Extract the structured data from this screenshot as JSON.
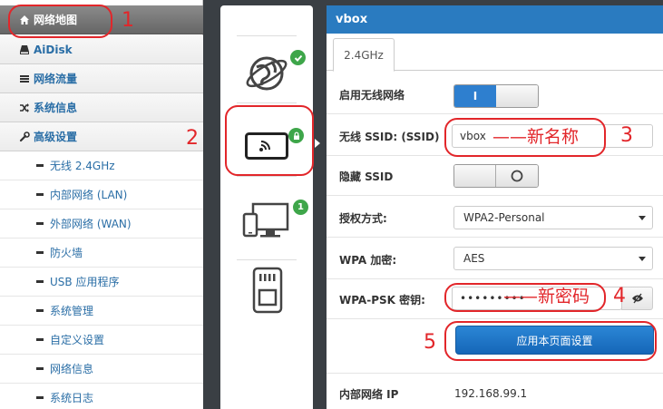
{
  "sidebar": {
    "main_items": [
      {
        "label": "网络地图",
        "icon": "home-icon"
      },
      {
        "label": "AiDisk",
        "icon": "disk-icon"
      },
      {
        "label": "网络流量",
        "icon": "list-icon"
      },
      {
        "label": "系统信息",
        "icon": "shuffle-icon"
      },
      {
        "label": "高级设置",
        "icon": "wrench-icon"
      }
    ],
    "sub_items": [
      {
        "label": "无线 2.4GHz"
      },
      {
        "label": "内部网络 (LAN)"
      },
      {
        "label": "外部网络 (WAN)"
      },
      {
        "label": "防火墙"
      },
      {
        "label": "USB 应用程序"
      },
      {
        "label": "系统管理"
      },
      {
        "label": "自定义设置"
      },
      {
        "label": "网络信息"
      },
      {
        "label": "系统日志"
      }
    ]
  },
  "iconcol": {
    "tiles": [
      {
        "name": "internet-globe-icon",
        "badge": "check"
      },
      {
        "name": "wireless-phone-icon",
        "badge": "lock"
      },
      {
        "name": "clients-devices-icon",
        "badge": "1"
      },
      {
        "name": "sd-card-icon"
      }
    ]
  },
  "panel": {
    "title": "vbox",
    "tab": "2.4GHz",
    "rows": {
      "enable_label": "启用无线网络",
      "enable_on_text": "I",
      "ssid_label": "无线 SSID: (SSID)",
      "ssid_value": "vbox",
      "hide_label": "隐藏 SSID",
      "auth_label": "授权方式:",
      "auth_value": "WPA2-Personal",
      "enc_label": "WPA 加密:",
      "enc_value": "AES",
      "psk_label": "WPA-PSK 密钥:",
      "psk_value": "•••••••••",
      "apply_label": "应用本页面设置",
      "lan_ip_label": "内部网络 IP",
      "lan_ip_value": "192.168.99.1"
    }
  },
  "annotations": {
    "nums": [
      "1",
      "2",
      "3",
      "4",
      "5"
    ],
    "ssid_note": "——新名称",
    "psk_note": "——新密码"
  },
  "colors": {
    "accent": "#2a7bc0",
    "annotation": "#e2262a",
    "badge": "#3ea64a"
  }
}
